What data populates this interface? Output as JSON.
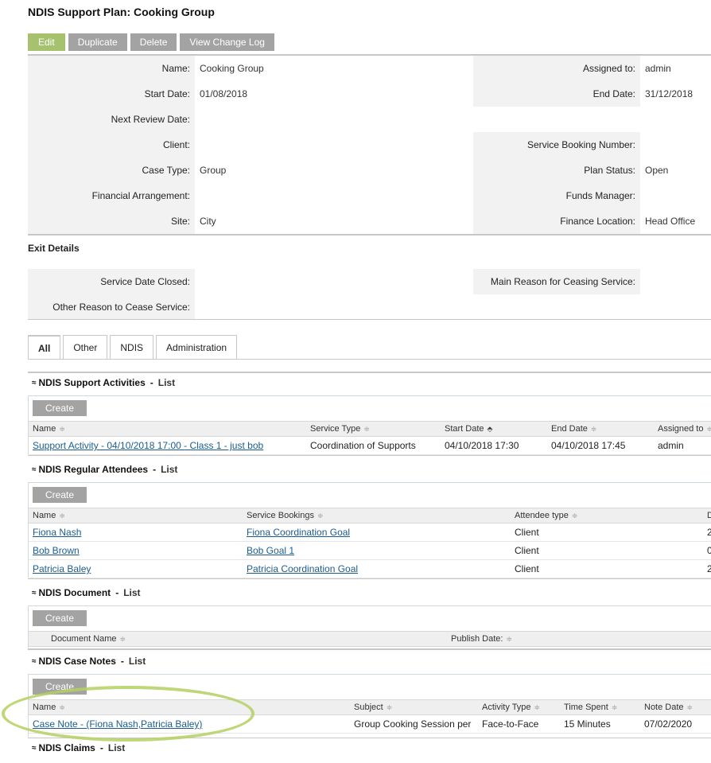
{
  "page": {
    "title": "NDIS Support Plan: Cooking Group"
  },
  "toolbar": {
    "edit": "Edit",
    "duplicate": "Duplicate",
    "delete": "Delete",
    "change_log": "View Change Log"
  },
  "details": {
    "rows": [
      {
        "l1": "Name:",
        "v1": "Cooking Group",
        "l2": "Assigned to:",
        "v2": "admin"
      },
      {
        "l1": "Start Date:",
        "v1": "01/08/2018",
        "l2": "End Date:",
        "v2": "31/12/2018"
      },
      {
        "l1": "Next Review Date:",
        "v1": "",
        "l2": "",
        "v2": ""
      },
      {
        "l1": "Client:",
        "v1": "",
        "l2": "Service Booking Number:",
        "v2": ""
      },
      {
        "l1": "Case Type:",
        "v1": "Group",
        "l2": "Plan Status:",
        "v2": "Open"
      },
      {
        "l1": "Financial Arrangement:",
        "v1": "",
        "l2": "Funds Manager:",
        "v2": ""
      },
      {
        "l1": "Site:",
        "v1": "City",
        "l2": "Finance Location:",
        "v2": "Head Office"
      }
    ]
  },
  "exit": {
    "title": "Exit Details",
    "rows": [
      {
        "l1": "Service Date Closed:",
        "v1": "",
        "l2": "Main Reason for Ceasing Service:",
        "v2": ""
      },
      {
        "l1": "Other Reason to Cease Service:",
        "v1": "",
        "l2": "",
        "v2": ""
      }
    ]
  },
  "tabs": [
    "All",
    "Other",
    "NDIS",
    "Administration"
  ],
  "list_label": "List",
  "create_label": "Create",
  "sort_glyph": "≑",
  "sort_up_glyph": "⬘",
  "activities": {
    "title": "NDIS Support Activities",
    "headers": [
      "Name",
      "Service Type",
      "Start Date",
      "End Date",
      "Assigned to"
    ],
    "rows": [
      [
        "Support Activity - 04/10/2018 17:00 - Class 1 - just bob",
        "Coordination of Supports",
        "04/10/2018 17:30",
        "04/10/2018 17:45",
        "admin"
      ]
    ]
  },
  "attendees": {
    "title": "NDIS Regular Attendees",
    "headers": [
      "Name",
      "Service Bookings",
      "Attendee type",
      "D"
    ],
    "rows": [
      [
        "Fiona Nash",
        "Fiona Coordination Goal",
        "Client",
        "2"
      ],
      [
        "Bob Brown",
        "Bob Goal 1",
        "Client",
        "0"
      ],
      [
        "Patricia Baley",
        "Patricia Coordination Goal",
        "Client",
        "2"
      ]
    ]
  },
  "documents": {
    "title": "NDIS Document",
    "headers": [
      "Document Name",
      "Publish Date:"
    ]
  },
  "case_notes": {
    "title": "NDIS Case Notes",
    "headers": [
      "Name",
      "Subject",
      "Activity Type",
      "Time Spent",
      "Note Date"
    ],
    "rows": [
      [
        "Case Note - (Fiona Nash,Patricia Baley)",
        "Group Cooking Session per",
        "Face-to-Face",
        "15 Minutes",
        "07/02/2020"
      ]
    ]
  },
  "claims": {
    "title": "NDIS Claims"
  }
}
